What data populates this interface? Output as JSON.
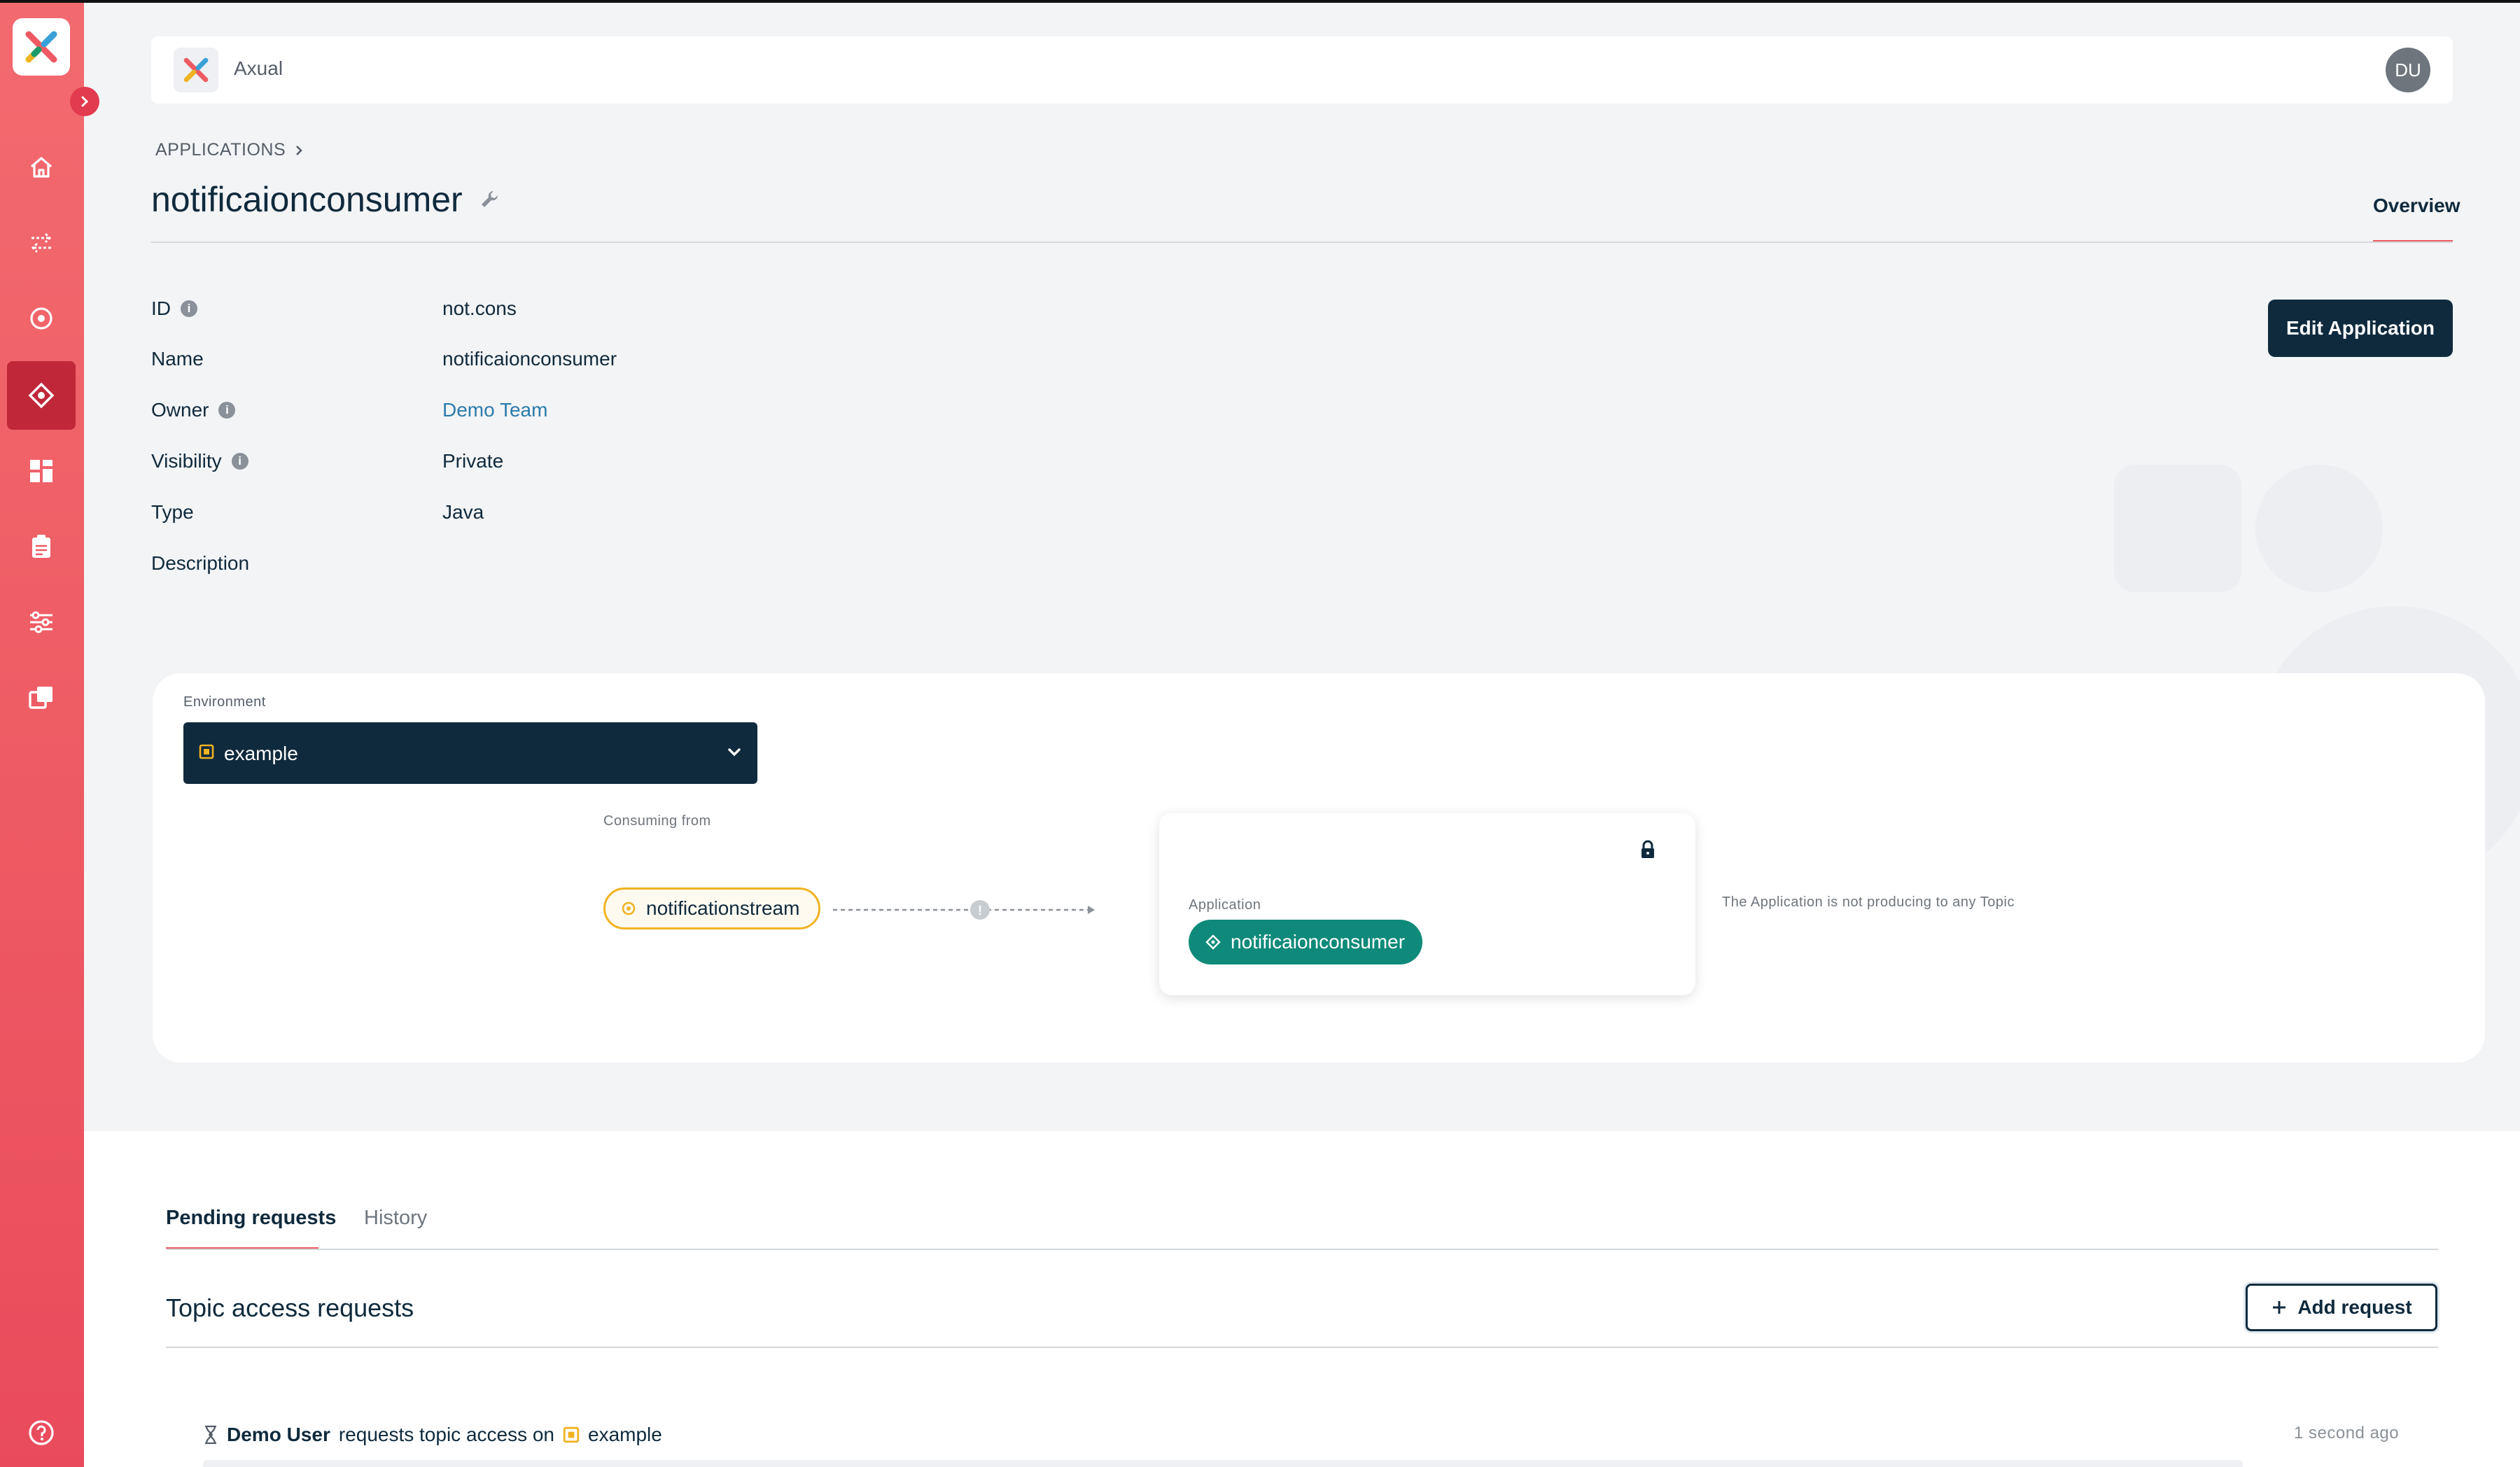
{
  "header": {
    "title": "Axual",
    "avatar": "DU"
  },
  "breadcrumb": {
    "root": "APPLICATIONS"
  },
  "page": {
    "title": "notificaionconsumer",
    "tab": "Overview"
  },
  "properties": [
    {
      "label": "ID",
      "value": "not.cons",
      "info": true
    },
    {
      "label": "Name",
      "value": "notificaionconsumer",
      "info": false
    },
    {
      "label": "Owner",
      "value": "Demo Team",
      "info": true,
      "link": true
    },
    {
      "label": "Visibility",
      "value": "Private",
      "info": true
    },
    {
      "label": "Type",
      "value": "Java",
      "info": false
    },
    {
      "label": "Description",
      "value": "",
      "info": false
    }
  ],
  "actions": {
    "edit_label": "Edit Application"
  },
  "diagram": {
    "environment_label": "Environment",
    "environment_value": "example",
    "consuming_label": "Consuming from",
    "stream_name": "notificationstream",
    "app_label": "Application",
    "app_name": "notificaionconsumer",
    "no_produce_text": "The Application is not producing to any Topic"
  },
  "requests": {
    "tabs": [
      "Pending requests",
      "History"
    ],
    "section_title": "Topic access requests",
    "add_label": "Add request",
    "items": [
      {
        "user": "Demo User",
        "text": "requests topic access on",
        "environment": "example",
        "time": "1 second ago"
      }
    ]
  },
  "colors": {
    "sidebar": "#ee5a63",
    "primary_dark": "#0f2a3d",
    "stream_accent": "#f0b323",
    "app_pill": "#0f8a7a",
    "link": "#2b7bab"
  },
  "sidebar": {
    "icons": [
      "home-icon",
      "streams-icon",
      "target-icon",
      "applications-icon",
      "dashboard-icon",
      "clipboard-icon",
      "settings-sliders-icon",
      "copy-icon",
      "help-icon"
    ],
    "active": "applications-icon"
  }
}
